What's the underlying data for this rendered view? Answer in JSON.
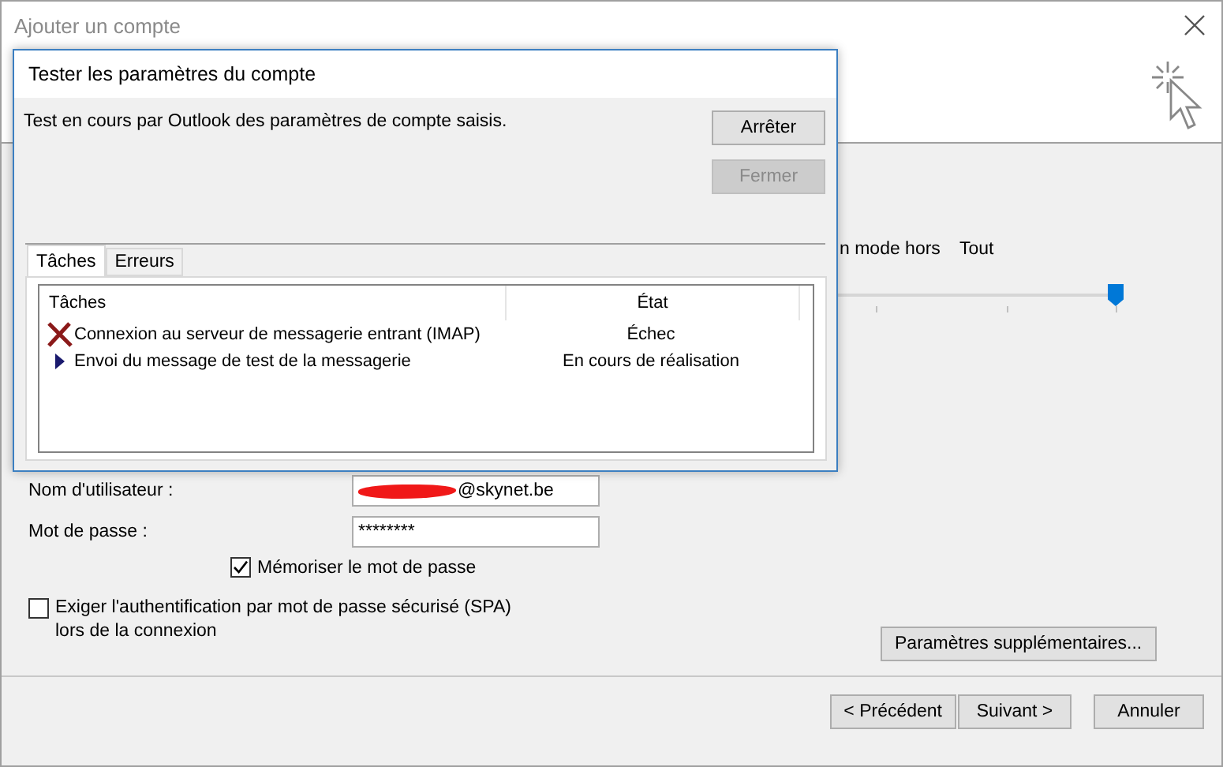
{
  "window": {
    "title": "Ajouter un compte"
  },
  "offline_setting": {
    "label": "n mode hors",
    "value": "Tout",
    "level": 1
  },
  "form": {
    "username": {
      "label": "Nom d'utilisateur :",
      "value": "@skynet.be"
    },
    "password": {
      "label": "Mot de passe :",
      "value": "********"
    },
    "remember": {
      "label": "Mémoriser le mot de passe",
      "checked": true
    },
    "spa": {
      "label": "Exiger l'authentification par mot de passe sécurisé (SPA) lors de la connexion",
      "checked": false
    },
    "more_settings_button": "Paramètres supplémentaires..."
  },
  "buttons": [
    "< Précédent",
    "Suivant >",
    "Annuler"
  ],
  "dialog": {
    "title": "Tester les paramètres du compte",
    "message": "Test en cours par Outlook des paramètres de compte saisis.",
    "buttons": [
      {
        "label": "Arrêter",
        "disabled": false
      },
      {
        "label": "Fermer",
        "disabled": true
      }
    ],
    "tabs": [
      {
        "label": "Tâches",
        "selected": true
      },
      {
        "label": "Erreurs",
        "selected": false
      }
    ],
    "table": {
      "columns": [
        "Tâches",
        "État"
      ],
      "rows": [
        {
          "kind": "failed",
          "task": "Connexion au serveur de messagerie entrant (IMAP)",
          "status": "Échec"
        },
        {
          "kind": "running",
          "task": "Envoi du message de test de la messagerie",
          "status": "En cours de réalisation"
        }
      ]
    }
  }
}
